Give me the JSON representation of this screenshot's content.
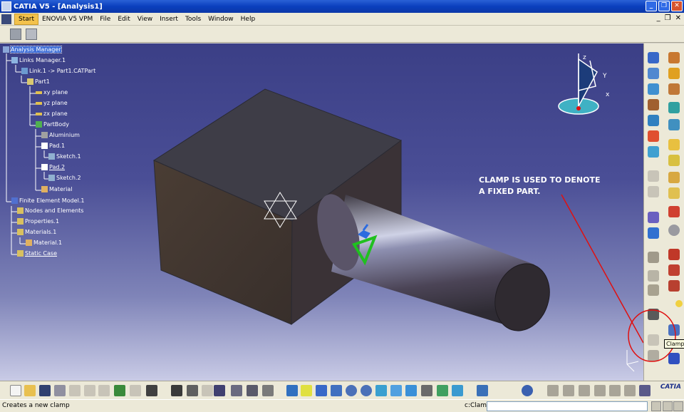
{
  "window": {
    "title": "CATIA V5 - [Analysis1]",
    "buttons": [
      "minimize",
      "restore",
      "close"
    ]
  },
  "menubar": {
    "items": [
      "Start",
      "ENOVIA V5 VPM",
      "File",
      "Edit",
      "View",
      "Insert",
      "Tools",
      "Window",
      "Help"
    ],
    "active": "Start"
  },
  "tree": {
    "nodes": [
      {
        "label": "Analysis Manager",
        "selected": true
      },
      {
        "label": "Links Manager.1"
      },
      {
        "label": "Link.1 -> Part1.CATPart"
      },
      {
        "label": "Part1"
      },
      {
        "label": "xy plane"
      },
      {
        "label": "yz plane"
      },
      {
        "label": "zx plane"
      },
      {
        "label": "PartBody"
      },
      {
        "label": "Aluminium"
      },
      {
        "label": "Pad.1"
      },
      {
        "label": "Sketch.1"
      },
      {
        "label": "Pad.2",
        "underlined": true
      },
      {
        "label": "Sketch.2"
      },
      {
        "label": "Material"
      },
      {
        "label": "Finite Element Model.1"
      },
      {
        "label": "Nodes and Elements"
      },
      {
        "label": "Properties.1"
      },
      {
        "label": "Materials.1"
      },
      {
        "label": "Material.1"
      },
      {
        "label": "Static Case",
        "underlined": true
      }
    ]
  },
  "annotation": {
    "line1": "CLAMP IS USED TO DENOTE",
    "line2": "A FIXED PART."
  },
  "compass": {
    "x": "x",
    "y": "Y",
    "z": "z"
  },
  "tooltip": "Clamp",
  "status": {
    "message": "Creates a new clamp",
    "command_label": "c:Clamp",
    "command_value": ""
  },
  "logo": "CATIA",
  "colors": {
    "title_bar": "#0c3fbd",
    "viewport_top": "#3b3f86",
    "viewport_bottom": "#c9cbe6",
    "annotation_circle": "#e01010",
    "clamp_symbol": "#20c020"
  }
}
